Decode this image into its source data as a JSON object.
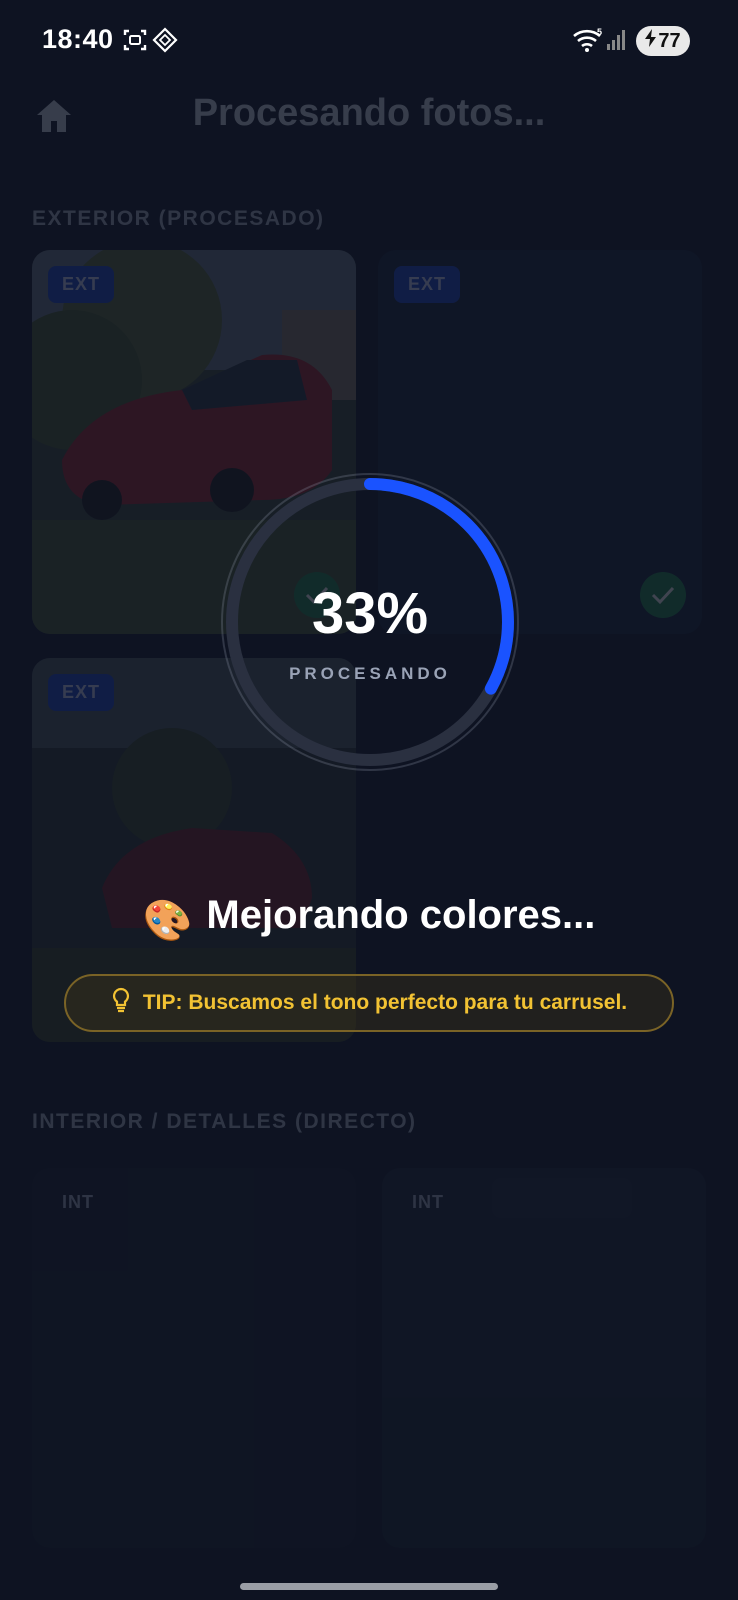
{
  "status_bar": {
    "time": "18:40",
    "battery": "77",
    "icons": [
      "screenshot-icon",
      "app-diamond-icon",
      "wifi-icon",
      "signal-icon",
      "charging-icon"
    ]
  },
  "header": {
    "title": "Procesando fotos...",
    "icon": "home-icon"
  },
  "sections": {
    "exterior_title": "EXTERIOR (PROCESADO)",
    "interior_title": "INTERIOR / DETALLES (DIRECTO)"
  },
  "exterior_photos": [
    {
      "tag": "EXT",
      "done": true
    },
    {
      "tag": "EXT",
      "done": true
    },
    {
      "tag": "EXT",
      "done": false
    }
  ],
  "interior_photos": [
    {
      "tag": "INT"
    },
    {
      "tag": "INT"
    }
  ],
  "progress": {
    "percent_text": "33%",
    "value": 0.33,
    "label": "PROCESANDO",
    "accent": "#1a53ff"
  },
  "status": {
    "emoji": "🎨",
    "message": "Mejorando colores..."
  },
  "tip": {
    "icon": "lightbulb-icon",
    "text": "TIP: Buscamos el tono perfecto para tu carrusel."
  }
}
